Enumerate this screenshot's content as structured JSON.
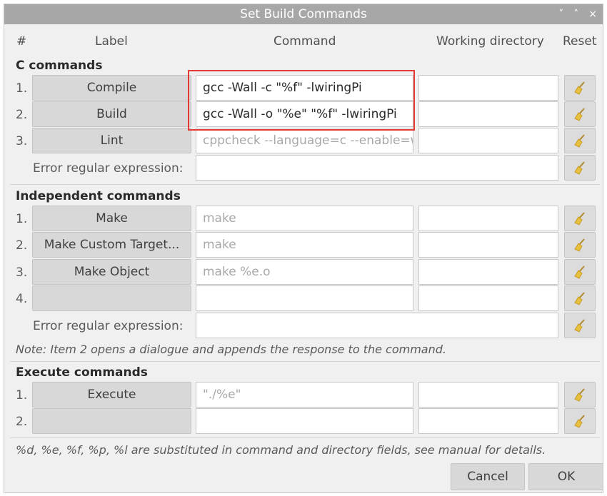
{
  "window": {
    "title": "Set Build Commands",
    "controls": [
      "˅",
      "˄",
      "×"
    ]
  },
  "headers": {
    "num": "#",
    "label": "Label",
    "command": "Command",
    "workdir": "Working directory",
    "reset": "Reset"
  },
  "c_commands": {
    "title": "C commands",
    "rows": [
      {
        "num": "1.",
        "label": "Compile",
        "command": "gcc -Wall -c \"%f\" -lwiringPi",
        "placeholder": false
      },
      {
        "num": "2.",
        "label": "Build",
        "command": "gcc -Wall -o \"%e\" \"%f\" -lwiringPi",
        "placeholder": false
      },
      {
        "num": "3.",
        "label": "Lint",
        "command": "cppcheck --language=c --enable=w",
        "placeholder": true
      }
    ],
    "error_regex_label": "Error regular expression:"
  },
  "independent_commands": {
    "title": "Independent commands",
    "rows": [
      {
        "num": "1.",
        "label": "Make",
        "command": "make",
        "placeholder": true
      },
      {
        "num": "2.",
        "label": "Make Custom Target...",
        "command": "make",
        "placeholder": true
      },
      {
        "num": "3.",
        "label": "Make Object",
        "command": "make %e.o",
        "placeholder": true
      },
      {
        "num": "4.",
        "label": "",
        "command": "",
        "placeholder": true
      }
    ],
    "error_regex_label": "Error regular expression:",
    "note": "Note: Item 2 opens a dialogue and appends the response to the command."
  },
  "execute_commands": {
    "title": "Execute commands",
    "rows": [
      {
        "num": "1.",
        "label": "Execute",
        "command": "\"./%e\"",
        "placeholder": true
      },
      {
        "num": "2.",
        "label": "",
        "command": "",
        "placeholder": true
      }
    ]
  },
  "footer_note": "%d, %e, %f, %p, %l are substituted in command and directory fields, see manual for details.",
  "buttons": {
    "cancel": "Cancel",
    "ok": "OK"
  },
  "colors": {
    "titlebar": "#a7a7a7",
    "highlight": "#e53935",
    "broom": "#e8c040"
  },
  "icons": {
    "reset": "broom-icon"
  }
}
